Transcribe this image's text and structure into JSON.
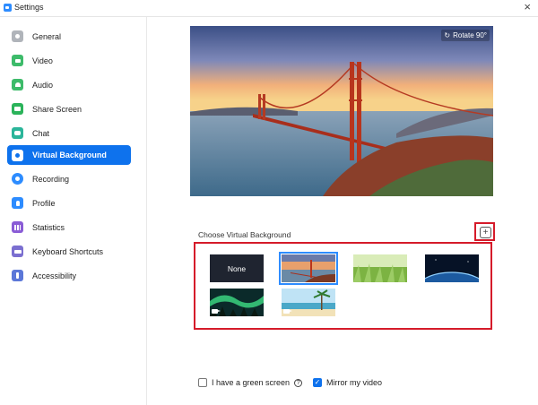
{
  "window": {
    "title": "Settings",
    "close_glyph": "×"
  },
  "sidebar": {
    "items": [
      {
        "label": "General",
        "icon": "gear-icon",
        "color": "#b0b4ba"
      },
      {
        "label": "Video",
        "icon": "video-camera-icon",
        "color": "#3dbb6a"
      },
      {
        "label": "Audio",
        "icon": "headphones-icon",
        "color": "#3dbb6a"
      },
      {
        "label": "Share Screen",
        "icon": "share-screen-icon",
        "color": "#2bb35a"
      },
      {
        "label": "Chat",
        "icon": "chat-bubble-icon",
        "color": "#2bb59a"
      },
      {
        "label": "Virtual Background",
        "icon": "person-card-icon",
        "color": "#0e72ed",
        "active": true
      },
      {
        "label": "Recording",
        "icon": "record-icon",
        "color": "#2d8cff"
      },
      {
        "label": "Profile",
        "icon": "user-icon",
        "color": "#2d8cff"
      },
      {
        "label": "Statistics",
        "icon": "bar-chart-icon",
        "color": "#8a5cd6"
      },
      {
        "label": "Keyboard Shortcuts",
        "icon": "keyboard-icon",
        "color": "#7b6fd0"
      },
      {
        "label": "Accessibility",
        "icon": "accessibility-icon",
        "color": "#5b77d8"
      }
    ]
  },
  "preview": {
    "rotate_label": "Rotate 90°"
  },
  "backgrounds": {
    "heading": "Choose Virtual Background",
    "add_glyph": "+",
    "items": [
      {
        "name": "None",
        "kind": "none"
      },
      {
        "name": "golden-gate-bridge",
        "kind": "image",
        "selected": true
      },
      {
        "name": "grass",
        "kind": "image"
      },
      {
        "name": "earth-from-space",
        "kind": "image"
      },
      {
        "name": "aurora",
        "kind": "video"
      },
      {
        "name": "beach",
        "kind": "video"
      }
    ]
  },
  "options": {
    "green_screen": {
      "label": "I have a green screen",
      "checked": false,
      "help_glyph": "?"
    },
    "mirror": {
      "label": "Mirror my video",
      "checked": true,
      "check_glyph": "✓"
    }
  },
  "colors": {
    "accent": "#0e72ed",
    "highlight": "#d51b2a"
  }
}
